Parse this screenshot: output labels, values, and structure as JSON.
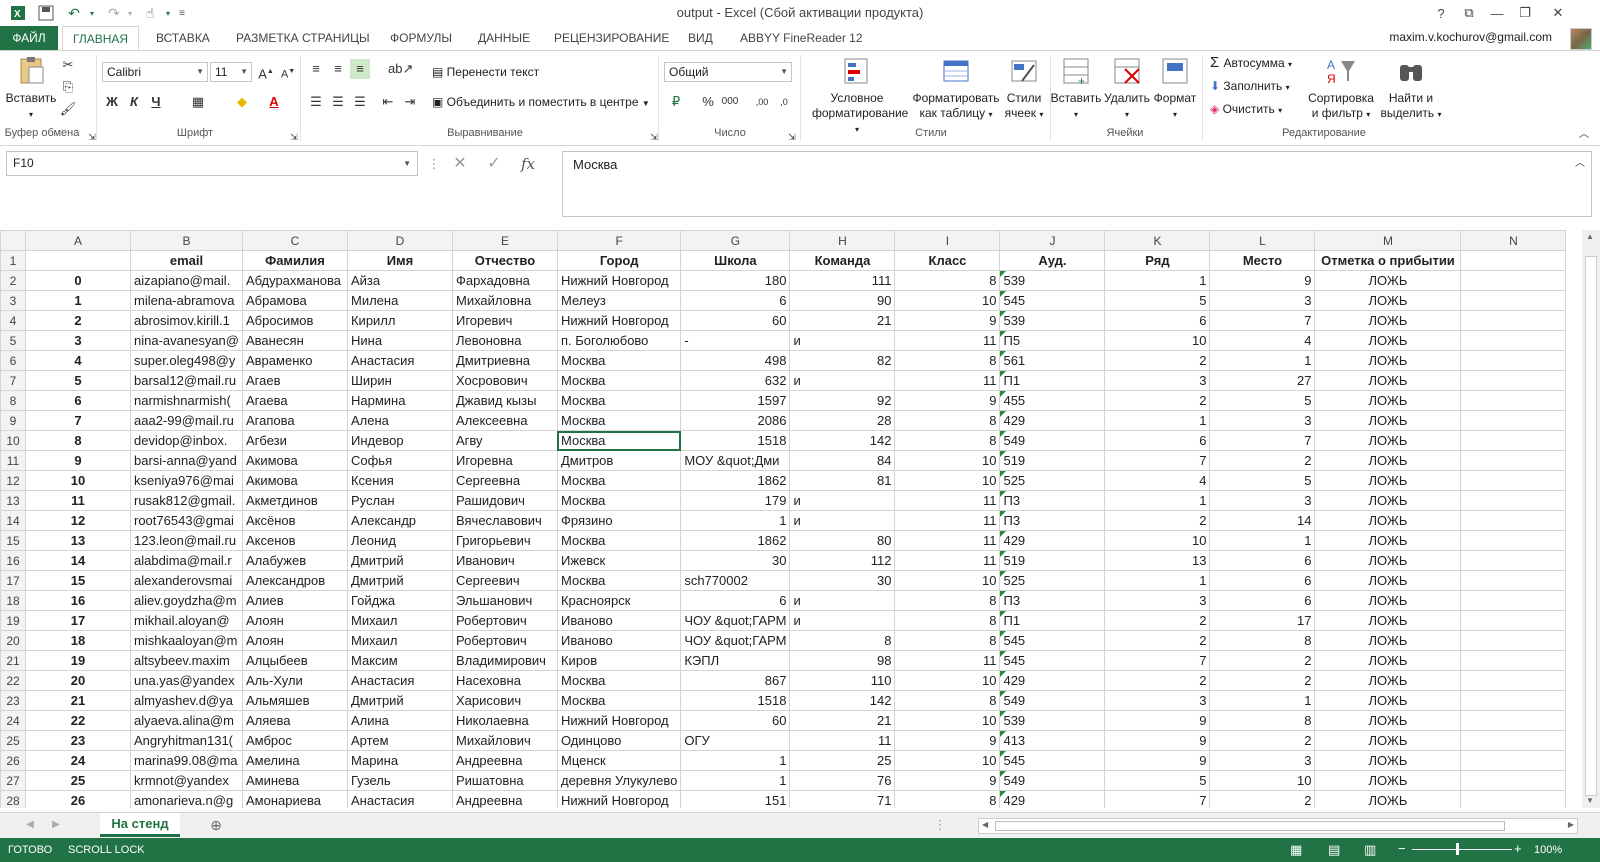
{
  "window": {
    "title": "output - Excel (Сбой активации продукта)",
    "account": "maxim.v.kochurov@gmail.com"
  },
  "tabs": [
    {
      "label": "ФАЙЛ"
    },
    {
      "label": "ГЛАВНАЯ"
    },
    {
      "label": "ВСТАВКА"
    },
    {
      "label": "РАЗМЕТКА СТРАНИЦЫ"
    },
    {
      "label": "ФОРМУЛЫ"
    },
    {
      "label": "ДАННЫЕ"
    },
    {
      "label": "РЕЦЕНЗИРОВАНИЕ"
    },
    {
      "label": "ВИД"
    },
    {
      "label": "ABBYY FineReader 12"
    }
  ],
  "ribbon": {
    "paste": "Вставить",
    "font_name": "Calibri",
    "font_size": "11",
    "bold": "Ж",
    "italic": "К",
    "underline": "Ч",
    "wrap_text": "Перенести текст",
    "merge_center": "Объединить и поместить в центре",
    "number_format": "Общий",
    "percent": "%",
    "thousands": "000",
    "cond_format_1": "Условное",
    "cond_format_2": "форматирование",
    "format_table_1": "Форматировать",
    "format_table_2": "как таблицу",
    "cell_styles_1": "Стили",
    "cell_styles_2": "ячеек",
    "insert": "Вставить",
    "delete": "Удалить",
    "format": "Формат",
    "autosum": "Автосумма",
    "fill": "Заполнить",
    "clear": "Очистить",
    "sort_1": "Сортировка",
    "sort_2": "и фильтр",
    "find_1": "Найти и",
    "find_2": "выделить",
    "groups": {
      "clipboard": "Буфер обмена",
      "font": "Шрифт",
      "alignment": "Выравнивание",
      "number": "Число",
      "styles": "Стили",
      "cells": "Ячейки",
      "editing": "Редактирование"
    }
  },
  "formula_bar": {
    "name_box": "F10",
    "formula": "Москва"
  },
  "columns": [
    "A",
    "B",
    "C",
    "D",
    "E",
    "F",
    "G",
    "H",
    "I",
    "J",
    "K",
    "L",
    "M",
    "N"
  ],
  "header_row": [
    "",
    "email",
    "Фамилия",
    "Имя",
    "Отчество",
    "Город",
    "Школа",
    "Команда",
    "Класс",
    "Ауд.",
    "Ряд",
    "Место",
    "Отметка о прибытии",
    ""
  ],
  "rows": [
    [
      "0",
      "aizapiano@mail.",
      "Абдурахманова",
      "Айза",
      "Фархадовна",
      "Нижний Новгород",
      "180",
      "111",
      "8",
      "539",
      "1",
      "9",
      "ЛОЖЬ"
    ],
    [
      "1",
      "milena-abramova",
      "Абрамова",
      "Милена",
      "Михайловна",
      "Мелеуз",
      "6",
      "90",
      "10",
      "545",
      "5",
      "3",
      "ЛОЖЬ"
    ],
    [
      "2",
      "abrosimov.kirill.1",
      "Абросимов",
      "Кирилл",
      "Игоревич",
      "Нижний Новгород",
      "60",
      "21",
      "9",
      "539",
      "6",
      "7",
      "ЛОЖЬ"
    ],
    [
      "3",
      "nina-avanesyan@",
      "Аванесян",
      "Нина",
      "Левоновна",
      "п. Боголюбово",
      "-",
      "и",
      "11",
      "П5",
      "10",
      "4",
      "ЛОЖЬ"
    ],
    [
      "4",
      "super.oleg498@y",
      "Авраменко",
      "Анастасия",
      "Дмитриевна",
      "Москва",
      "498",
      "82",
      "8",
      "561",
      "2",
      "1",
      "ЛОЖЬ"
    ],
    [
      "5",
      "barsal12@mail.ru",
      "Агаев",
      "Ширин",
      "Хосровович",
      "Москва",
      "632",
      "и",
      "11",
      "П1",
      "3",
      "27",
      "ЛОЖЬ"
    ],
    [
      "6",
      "narmishnarmish(",
      "Агаева",
      "Нармина",
      "Джавид кызы",
      "Москва",
      "1597",
      "92",
      "9",
      "455",
      "2",
      "5",
      "ЛОЖЬ"
    ],
    [
      "7",
      "aaa2-99@mail.ru",
      "Агапова",
      "Алена",
      "Алексеевна",
      "Москва",
      "2086",
      "28",
      "8",
      "429",
      "1",
      "3",
      "ЛОЖЬ"
    ],
    [
      "8",
      "devidop@inbox.",
      "Агбези",
      "Индевор",
      "Агву",
      "Москва",
      "1518",
      "142",
      "8",
      "549",
      "6",
      "7",
      "ЛОЖЬ"
    ],
    [
      "9",
      "barsi-anna@yand",
      "Акимова",
      "Софья",
      "Игоревна",
      "Дмитров",
      "МОУ &quot;Дми",
      "84",
      "10",
      "519",
      "7",
      "2",
      "ЛОЖЬ"
    ],
    [
      "10",
      "kseniya976@mai",
      "Акимова",
      "Ксения",
      "Сергеевна",
      "Москва",
      "1862",
      "81",
      "10",
      "525",
      "4",
      "5",
      "ЛОЖЬ"
    ],
    [
      "11",
      "rusak812@gmail.",
      "Акметдинов",
      "Руслан",
      "Рашидович",
      "Москва",
      "179",
      "и",
      "11",
      "П3",
      "1",
      "3",
      "ЛОЖЬ"
    ],
    [
      "12",
      "root76543@gmai",
      "Аксёнов",
      "Александр",
      "Вячеславович",
      "Фрязино",
      "1",
      "и",
      "11",
      "П3",
      "2",
      "14",
      "ЛОЖЬ"
    ],
    [
      "13",
      "123.leon@mail.ru",
      "Аксенов",
      "Леонид",
      "Григорьевич",
      "Москва",
      "1862",
      "80",
      "11",
      "429",
      "10",
      "1",
      "ЛОЖЬ"
    ],
    [
      "14",
      "alabdima@mail.r",
      "Алабужев",
      "Дмитрий",
      "Иванович",
      "Ижевск",
      "30",
      "112",
      "11",
      "519",
      "13",
      "6",
      "ЛОЖЬ"
    ],
    [
      "15",
      "alexanderovsmai",
      "Александров",
      "Дмитрий",
      "Сергеевич",
      "Москва",
      "sch770002",
      "30",
      "10",
      "525",
      "1",
      "6",
      "ЛОЖЬ"
    ],
    [
      "16",
      "aliev.goydzha@m",
      "Алиев",
      "Гойджа",
      "Эльшанович",
      "Красноярск",
      "6",
      "и",
      "8",
      "П3",
      "3",
      "6",
      "ЛОЖЬ"
    ],
    [
      "17",
      "mikhail.aloyan@",
      "Алоян",
      "Михаил",
      "Робертович",
      "Иваново",
      "ЧОУ &quot;ГАРМ",
      "и",
      "8",
      "П1",
      "2",
      "17",
      "ЛОЖЬ"
    ],
    [
      "18",
      "mishkaaloyan@m",
      "Алоян",
      "Михаил",
      "Робертович",
      "Иваново",
      "ЧОУ &quot;ГАРМ",
      "8",
      "8",
      "545",
      "2",
      "8",
      "ЛОЖЬ"
    ],
    [
      "19",
      "altsybeev.maxim",
      "Алцыбеев",
      "Максим",
      "Владимирович",
      "Киров",
      "КЭПЛ",
      "98",
      "11",
      "545",
      "7",
      "2",
      "ЛОЖЬ"
    ],
    [
      "20",
      "una.yas@yandex",
      "Аль-Хули",
      "Анастасия",
      "Насеховна",
      "Москва",
      "867",
      "110",
      "10",
      "429",
      "2",
      "2",
      "ЛОЖЬ"
    ],
    [
      "21",
      "almyashev.d@ya",
      "Альмяшев",
      "Дмитрий",
      "Харисович",
      "Москва",
      "1518",
      "142",
      "8",
      "549",
      "3",
      "1",
      "ЛОЖЬ"
    ],
    [
      "22",
      "alyaeva.alina@m",
      "Аляева",
      "Алина",
      "Николаевна",
      "Нижний Новгород",
      "60",
      "21",
      "10",
      "539",
      "9",
      "8",
      "ЛОЖЬ"
    ],
    [
      "23",
      "Angryhitman131(",
      "Амброс",
      "Артем",
      "Михайлович",
      "Одинцово",
      "ОГУ",
      "11",
      "9",
      "413",
      "9",
      "2",
      "ЛОЖЬ"
    ],
    [
      "24",
      "marina99.08@ma",
      "Амелина",
      "Марина",
      "Андреевна",
      "Мценск",
      "1",
      "25",
      "10",
      "545",
      "9",
      "3",
      "ЛОЖЬ"
    ],
    [
      "25",
      "krmnot@yandex",
      "Аминева",
      "Гузель",
      "Ришатовна",
      "деревня Улукулево",
      "1",
      "76",
      "9",
      "549",
      "5",
      "10",
      "ЛОЖЬ"
    ],
    [
      "26",
      "amonarieva.n@g",
      "Амонариева",
      "Анастасия",
      "Андреевна",
      "Нижний Новгород",
      "151",
      "71",
      "8",
      "429",
      "7",
      "2",
      "ЛОЖЬ"
    ]
  ],
  "sheet_tab": "На стенд",
  "status": {
    "ready": "ГОТОВО",
    "scroll_lock": "SCROLL LOCK",
    "zoom": "100%"
  },
  "colors": {
    "accent": "#217346"
  }
}
